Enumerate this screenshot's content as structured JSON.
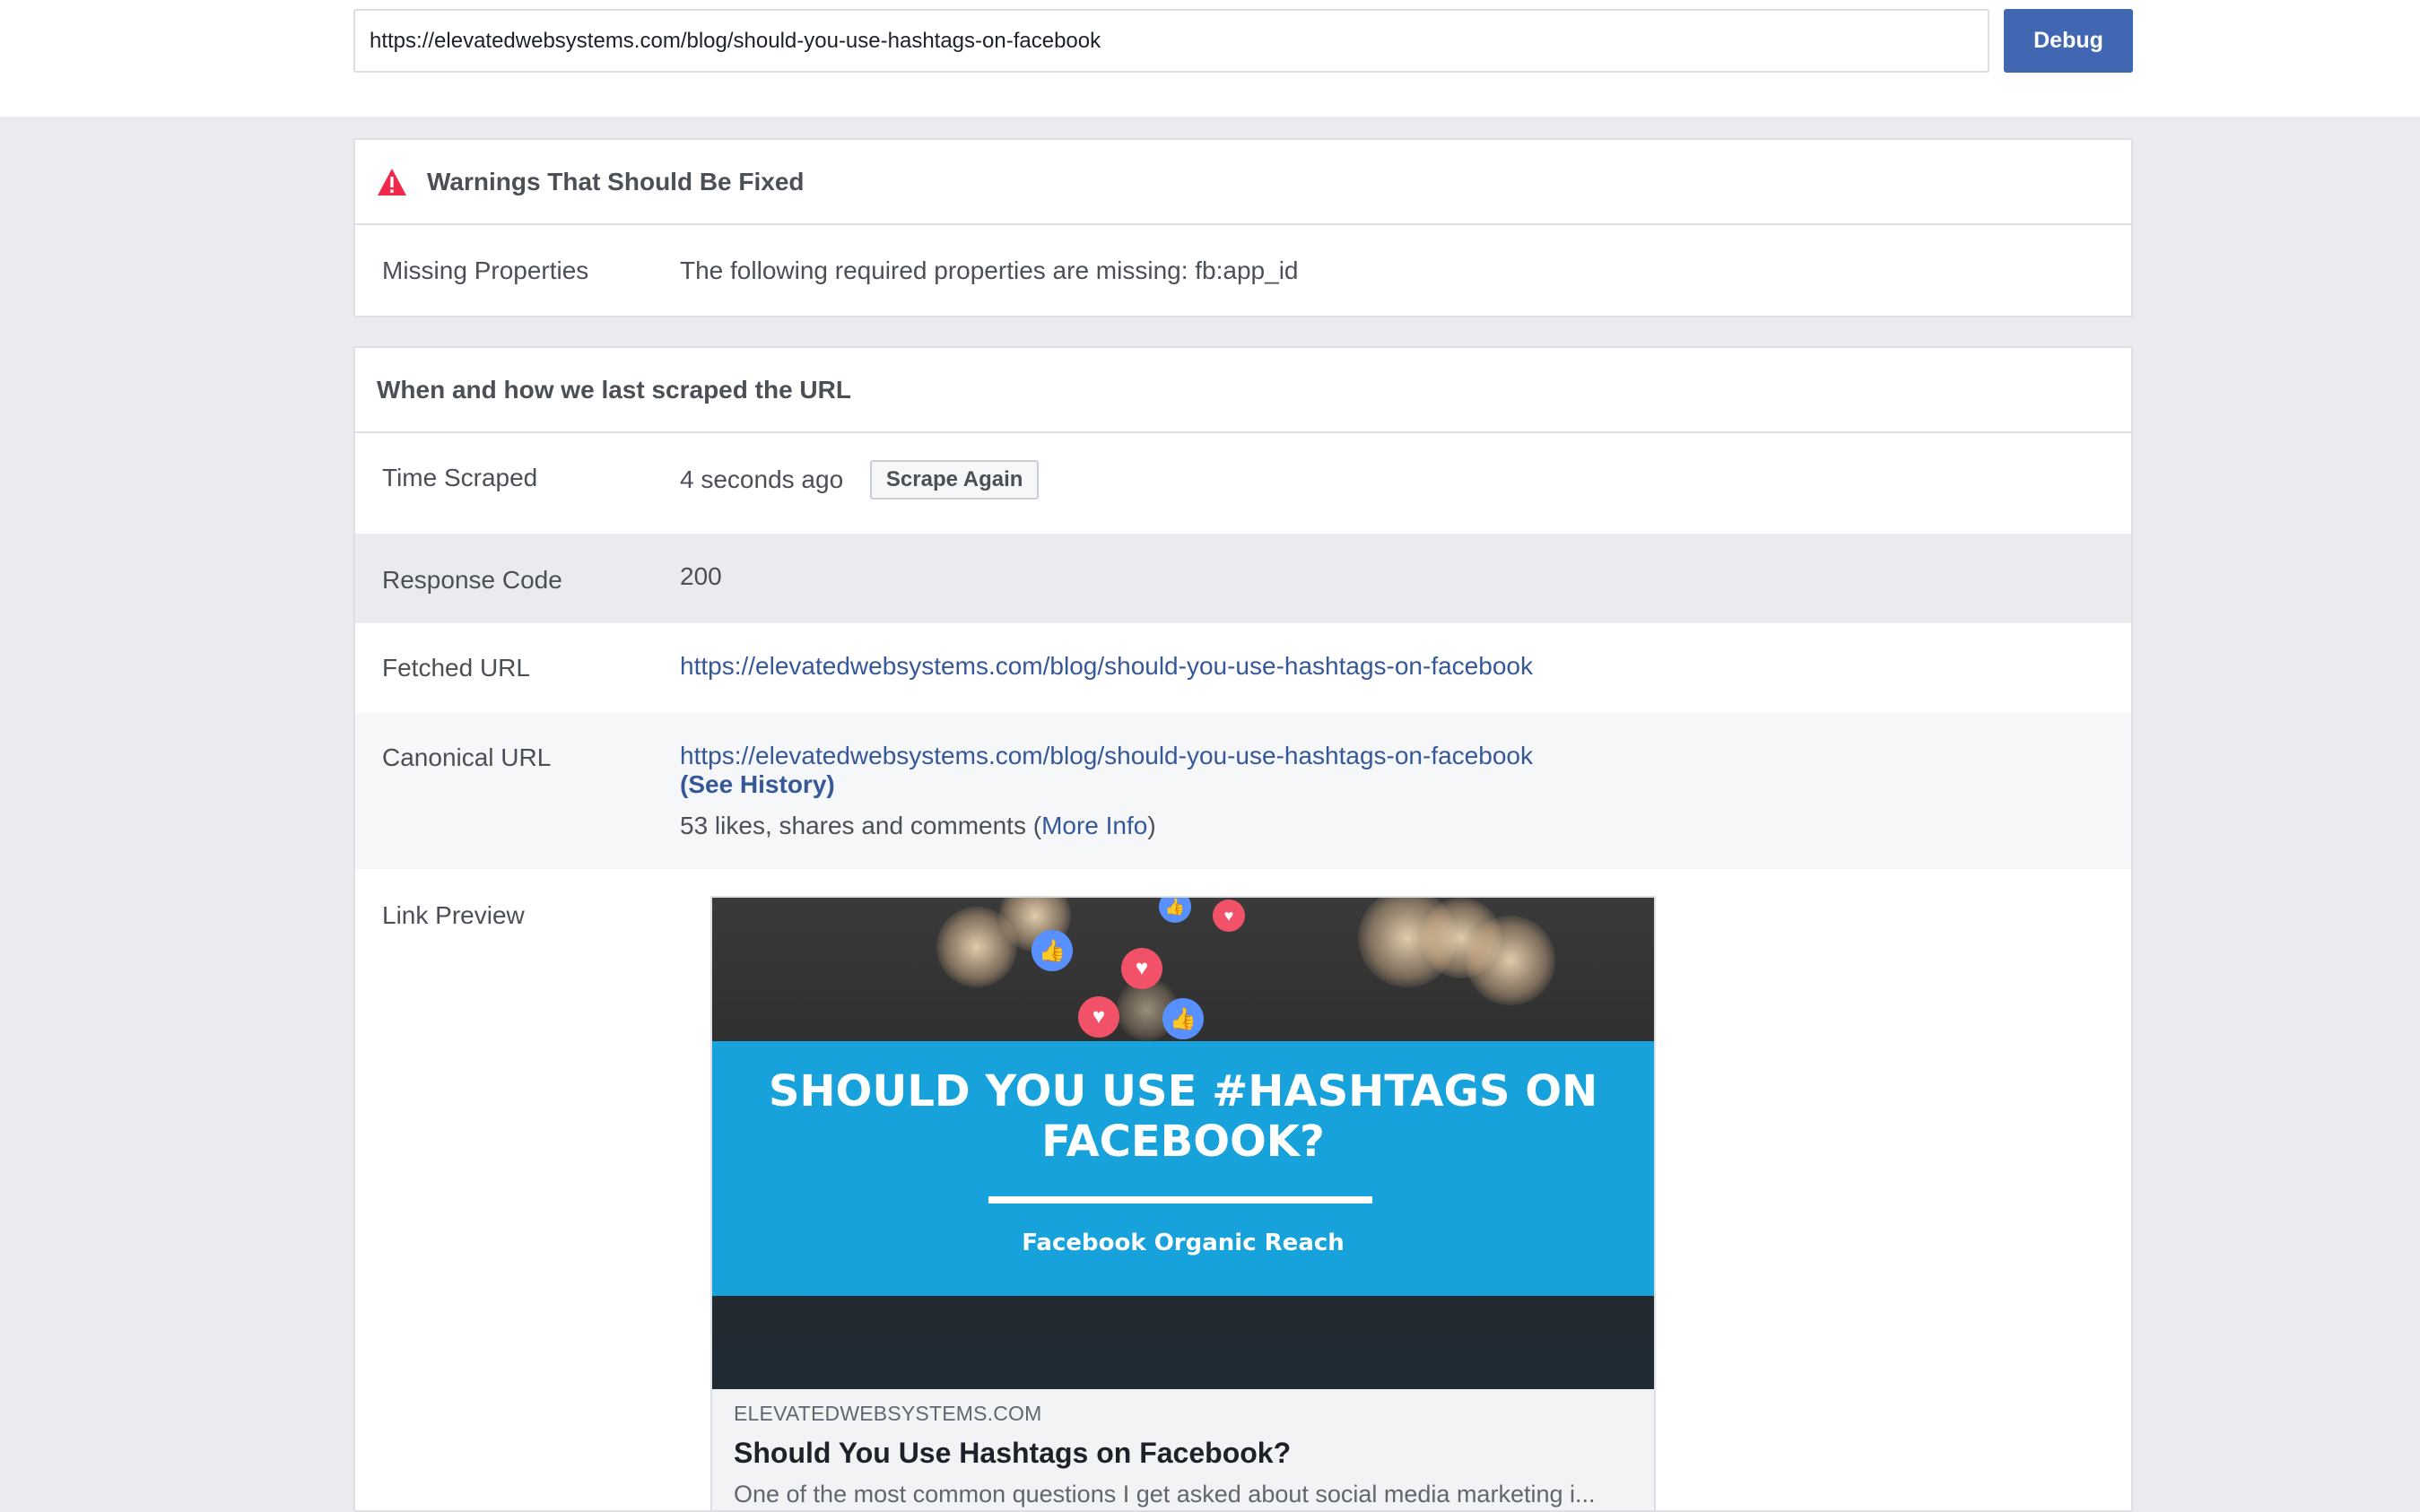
{
  "search": {
    "url_value": "https://elevatedwebsystems.com/blog/should-you-use-hashtags-on-facebook",
    "debug_label": "Debug"
  },
  "warnings": {
    "title": "Warnings That Should Be Fixed",
    "icon": "warning-triangle-icon",
    "icon_color": "#f02849",
    "rows": [
      {
        "label": "Missing Properties",
        "value": "The following required properties are missing: fb:app_id"
      }
    ]
  },
  "scrape": {
    "title": "When and how we last scraped the URL",
    "time_scraped": {
      "label": "Time Scraped",
      "value": "4 seconds ago",
      "button": "Scrape Again"
    },
    "response_code": {
      "label": "Response Code",
      "value": "200"
    },
    "fetched_url": {
      "label": "Fetched URL",
      "value": "https://elevatedwebsystems.com/blog/should-you-use-hashtags-on-facebook"
    },
    "canonical_url": {
      "label": "Canonical URL",
      "value": "https://elevatedwebsystems.com/blog/should-you-use-hashtags-on-facebook",
      "history_link": "(See History)",
      "engagement_prefix": "53 likes, shares and comments (",
      "more_info": "More Info",
      "engagement_suffix": ")"
    },
    "link_preview": {
      "label": "Link Preview",
      "image_title": "SHOULD YOU USE #HASHTAGS ON FACEBOOK?",
      "image_subtitle": "Facebook Organic Reach",
      "domain": "ELEVATEDWEBSYSTEMS.COM",
      "title": "Should You Use Hashtags on Facebook?",
      "description": "One of the most common questions I get asked about social media marketing i..."
    }
  },
  "colors": {
    "brand_blue": "#4267b2",
    "link_blue": "#365899",
    "banner_blue": "#17a2db",
    "page_bg": "#e9ebee"
  }
}
